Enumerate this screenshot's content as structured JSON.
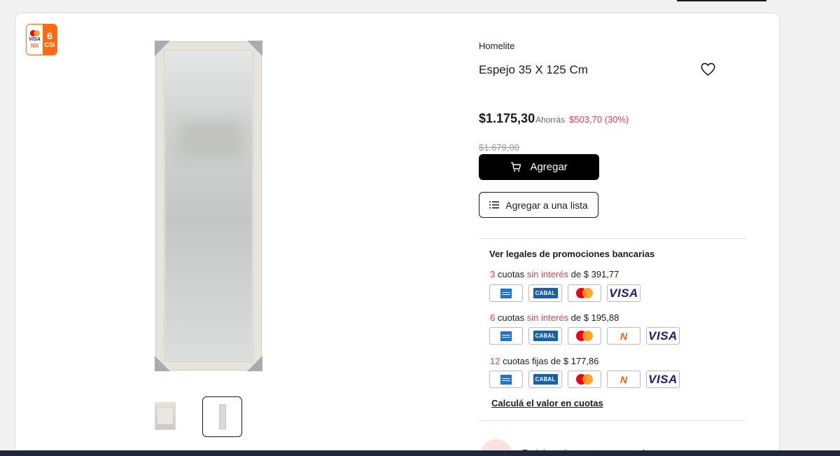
{
  "badge": {
    "number": "6",
    "text": "CSI",
    "visa": "VISA",
    "nx": "NX"
  },
  "product": {
    "brand": "Homelite",
    "title": "Espejo 35 X 125 Cm",
    "price": "$1.175,30",
    "savings_label": "Ahorrás",
    "savings_value": "$503,70 (30%)",
    "old_price": "$1.679,00"
  },
  "buttons": {
    "add_label": "Agregar",
    "add_to_list_label": "Agregar a una lista"
  },
  "promotions": {
    "title": "Ver legales de promociones bancarias",
    "installments": [
      {
        "count": "3",
        "word": "cuotas",
        "tag": "sin interés",
        "amount": "de $ 391,77",
        "cards": [
          "amex",
          "cabal",
          "mastercard",
          "visa"
        ]
      },
      {
        "count": "6",
        "word": "cuotas",
        "tag": "sin interés",
        "amount": "de $ 195,88",
        "cards": [
          "amex",
          "cabal",
          "mastercard",
          "naranja",
          "visa"
        ]
      },
      {
        "count": "12",
        "word": "cuotas",
        "tag": "fijas",
        "amount": "de $ 177,86",
        "cards": [
          "amex",
          "cabal",
          "mastercard",
          "naranja",
          "visa"
        ]
      }
    ],
    "calc_link": "Calculá el valor en cuotas",
    "card_labels": {
      "cabal": "CABAL",
      "visa": "VISA",
      "naranja": "N"
    }
  },
  "bottom": {
    "partial_text": "Retirá gratis en estas sucursales"
  },
  "colors": {
    "accent": "#e4404a",
    "badge_orange": "#ff6a13",
    "primary_button": "#000000"
  }
}
